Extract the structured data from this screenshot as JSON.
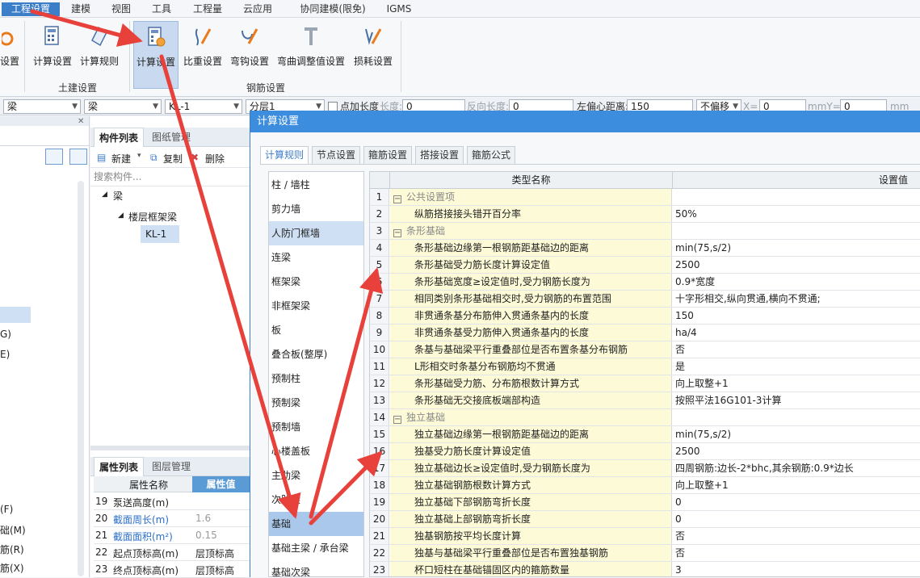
{
  "menu": [
    "工程设置",
    "建模",
    "视图",
    "工具",
    "工程量",
    "云应用",
    "协同建模(限免)",
    "IGMS"
  ],
  "ribbon": {
    "partial_label": "设置",
    "group1_label": "土建设置",
    "group2_label": "钢筋设置",
    "buttons": [
      "计算设置",
      "计算规则",
      "计算设置",
      "比重设置",
      "弯钩设置",
      "弯曲调整值设置",
      "损耗设置"
    ]
  },
  "toolbar": {
    "combo1": "梁",
    "combo2": "梁",
    "combo3": "KL-1",
    "combo4": "分层1",
    "point_length": "点加长度",
    "length_label": "长度:",
    "length_val": "0",
    "rev_label": "反向长度:",
    "rev_val": "0",
    "offset_label": "左偏心距离:",
    "offset_val": "150",
    "nooffset": "不偏移",
    "x_label": "X=",
    "x_val": "0",
    "y_label": "mmY=",
    "y_val": "0",
    "mm": "mm"
  },
  "left_pane": {
    "partial_items": [
      "G)",
      "E)",
      "(F)",
      "础(M)",
      "筋(R)",
      "筋(X)"
    ]
  },
  "mid_pane": {
    "tab_list": "构件列表",
    "tab_drawing": "图纸管理",
    "new": "新建",
    "copy": "复制",
    "delete": "删除",
    "search_placeholder": "搜索构件...",
    "tree": [
      "梁",
      "楼层框架梁",
      "KL-1"
    ],
    "prop_tab": "属性列表",
    "layer_tab": "图层管理",
    "prop_head_name": "属性名称",
    "prop_head_val": "属性值",
    "props": [
      {
        "n": "19",
        "name": "泵送高度(m)",
        "val": ""
      },
      {
        "n": "20",
        "name": "截面周长(m)",
        "val": "1.6"
      },
      {
        "n": "21",
        "name": "截面面积(m²)",
        "val": "0.15"
      },
      {
        "n": "22",
        "name": "起点顶标高(m)",
        "val": "层顶标高"
      },
      {
        "n": "23",
        "name": "终点顶标高(m)",
        "val": "层顶标高"
      }
    ]
  },
  "dialog": {
    "title": "计算设置",
    "tabs": [
      "计算规则",
      "节点设置",
      "箍筋设置",
      "搭接设置",
      "箍筋公式"
    ],
    "categories": [
      "柱 / 墙柱",
      "剪力墙",
      "人防门框墙",
      "连梁",
      "框架梁",
      "非框架梁",
      "板",
      "叠合板(整厚)",
      "预制柱",
      "预制梁",
      "预制墙",
      "心楼盖板",
      "主肋梁",
      "次肋梁",
      "基础",
      "基础主梁 / 承台梁",
      "基础次梁"
    ],
    "col_name": "类型名称",
    "col_val": "设置值",
    "rows": [
      {
        "n": "1",
        "name": "公共设置项",
        "val": "",
        "group": true
      },
      {
        "n": "2",
        "name": "纵筋搭接接头错开百分率",
        "val": "50%"
      },
      {
        "n": "3",
        "name": "条形基础",
        "val": "",
        "group": true
      },
      {
        "n": "4",
        "name": "条形基础边缘第一根钢筋距基础边的距离",
        "val": "min(75,s/2)"
      },
      {
        "n": "5",
        "name": "条形基础受力筋长度计算设定值",
        "val": "2500"
      },
      {
        "n": "6",
        "name": "条形基础宽度≥设定值时,受力钢筋长度为",
        "val": "0.9*宽度"
      },
      {
        "n": "7",
        "name": "相同类别条形基础相交时,受力钢筋的布置范围",
        "val": "十字形相交,纵向贯通,横向不贯通;"
      },
      {
        "n": "8",
        "name": "非贯通条基分布筋伸入贯通条基内的长度",
        "val": "150"
      },
      {
        "n": "9",
        "name": "非贯通条基受力筋伸入贯通条基内的长度",
        "val": "ha/4"
      },
      {
        "n": "10",
        "name": "条基与基础梁平行重叠部位是否布置条基分布钢筋",
        "val": "否"
      },
      {
        "n": "11",
        "name": "L形相交时条基分布钢筋均不贯通",
        "val": "是"
      },
      {
        "n": "12",
        "name": "条形基础受力筋、分布筋根数计算方式",
        "val": "向上取整+1"
      },
      {
        "n": "13",
        "name": "条形基础无交接底板端部构造",
        "val": "按照平法16G101-3计算"
      },
      {
        "n": "14",
        "name": "独立基础",
        "val": "",
        "group": true
      },
      {
        "n": "15",
        "name": "独立基础边缘第一根钢筋距基础边的距离",
        "val": "min(75,s/2)"
      },
      {
        "n": "16",
        "name": "独基受力筋长度计算设定值",
        "val": "2500"
      },
      {
        "n": "17",
        "name": "独立基础边长≥设定值时,受力钢筋长度为",
        "val": "四周钢筋:边长-2*bhc,其余钢筋:0.9*边长"
      },
      {
        "n": "18",
        "name": "独立基础钢筋根数计算方式",
        "val": "向上取整+1"
      },
      {
        "n": "19",
        "name": "独立基础下部钢筋弯折长度",
        "val": "0"
      },
      {
        "n": "20",
        "name": "独立基础上部钢筋弯折长度",
        "val": "0"
      },
      {
        "n": "21",
        "name": "独基钢筋按平均长度计算",
        "val": "否"
      },
      {
        "n": "22",
        "name": "独基与基础梁平行重叠部位是否布置独基钢筋",
        "val": "否"
      },
      {
        "n": "23",
        "name": "杯口短柱在基础锚固区内的箍筋数量",
        "val": "3"
      }
    ]
  },
  "colors": {
    "accent": "#3d7ec9",
    "arrow": "#e8403a",
    "selection": "#c9daf0"
  }
}
